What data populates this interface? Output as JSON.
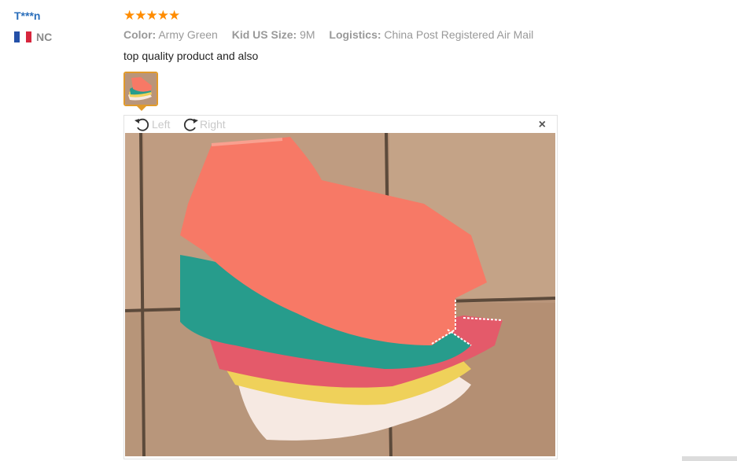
{
  "reviewer": {
    "name": "T***n",
    "country_code": "NC",
    "flag_colors": [
      "#2450a8",
      "#ffffff",
      "#d7263d"
    ]
  },
  "rating": {
    "stars": 5,
    "max": 5,
    "color": "#ff8c00"
  },
  "attributes": [
    {
      "key": "Color:",
      "value": "Army Green"
    },
    {
      "key": "Kid US Size:",
      "value": "9M"
    },
    {
      "key": "Logistics:",
      "value": "China Post Registered Air Mail"
    }
  ],
  "review_text": "top quality product and also",
  "viewer": {
    "rotate_left_label": "Left",
    "rotate_right_label": "Right",
    "close_symbol": "×"
  },
  "photo": {
    "subject": "stack-of-baby-bodysuits",
    "floor_color": "#b9957a",
    "garment_colors": [
      "#f77966",
      "#279c8c",
      "#e45a6a",
      "#efd15a",
      "#f6e9e2"
    ]
  }
}
